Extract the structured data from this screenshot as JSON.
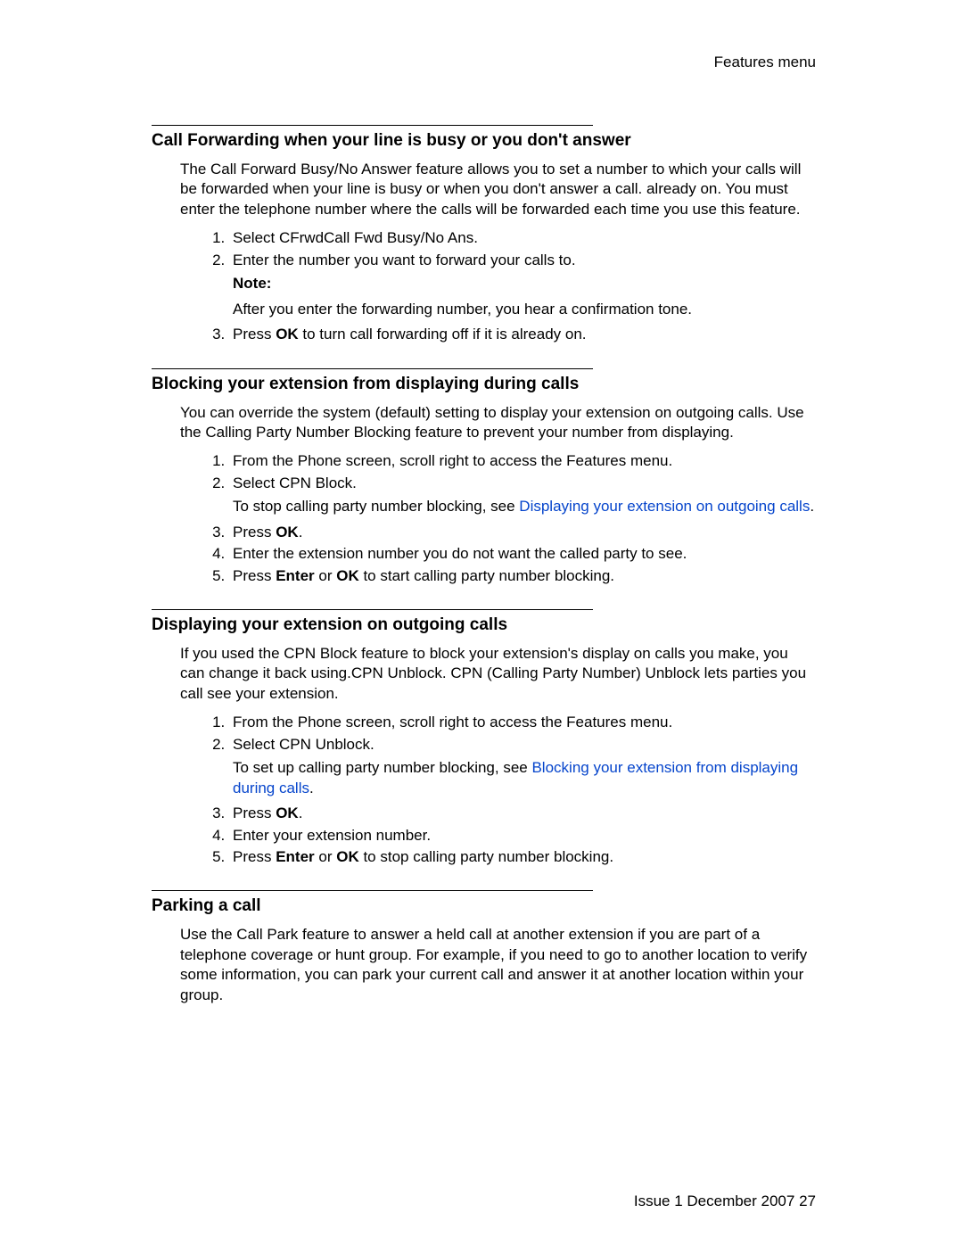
{
  "header": {
    "title": "Features menu"
  },
  "footer": {
    "left": "Issue 1 December 2007",
    "right": "27"
  },
  "section1": {
    "title": "Call Forwarding when your line is busy or you don't answer",
    "para": "The Call Forward Busy/No Answer feature allows you to set a number to which your calls will be forwarded when your line is busy or when you don't answer a call. already on. You must enter the telephone number where the calls will be forwarded each time you use this feature.",
    "step1": "Select CFrwdCall Fwd Busy/No Ans.",
    "step2": "Enter the number you want to forward your calls to.",
    "note_label": "Note:",
    "note_body": "After you enter the forwarding number, you hear a confirmation tone.",
    "step3_pre": "Press ",
    "step3_bold": "OK",
    "step3_post": " to turn call forwarding off if it is already on."
  },
  "section2": {
    "title": "Blocking your extension from displaying during calls",
    "para": "You can override the system (default) setting to display your extension on outgoing calls. Use the Calling Party Number Blocking feature to prevent your number from displaying.",
    "step1": "From the Phone screen, scroll right to access the Features menu.",
    "step2": "Select CPN Block.",
    "step2_sub_pre": "To stop calling party number blocking, see ",
    "step2_sub_link": "Displaying your extension on outgoing calls",
    "step2_sub_post": ".",
    "step3_pre": "Press ",
    "step3_bold": "OK",
    "step3_post": ".",
    "step4": "Enter the extension number you do not want the called party to see.",
    "step5_pre": "Press ",
    "step5_b1": "Enter",
    "step5_mid": " or ",
    "step5_b2": "OK",
    "step5_post": " to start calling party number blocking."
  },
  "section3": {
    "title": "Displaying your extension on outgoing calls",
    "para": "If you used the CPN Block feature to block your extension's display on calls you make, you can change it back using.CPN Unblock. CPN (Calling Party Number) Unblock lets parties you call see your extension.",
    "step1": "From the Phone screen, scroll right to access the Features menu.",
    "step2": "Select CPN Unblock.",
    "step2_sub_pre": "To set up calling party number blocking, see ",
    "step2_sub_link": "Blocking your extension from displaying during calls",
    "step2_sub_post": ".",
    "step3_pre": "Press ",
    "step3_bold": "OK",
    "step3_post": ".",
    "step4": "Enter your extension number.",
    "step5_pre": "Press ",
    "step5_b1": "Enter",
    "step5_mid": " or ",
    "step5_b2": "OK",
    "step5_post": " to stop calling party number blocking."
  },
  "section4": {
    "title": "Parking a call",
    "para": "Use the Call Park feature to answer a held call at another extension if you are part of a telephone coverage or hunt group. For example, if you need to go to another location to verify some information, you can park your current call and answer it at another location within your group."
  }
}
